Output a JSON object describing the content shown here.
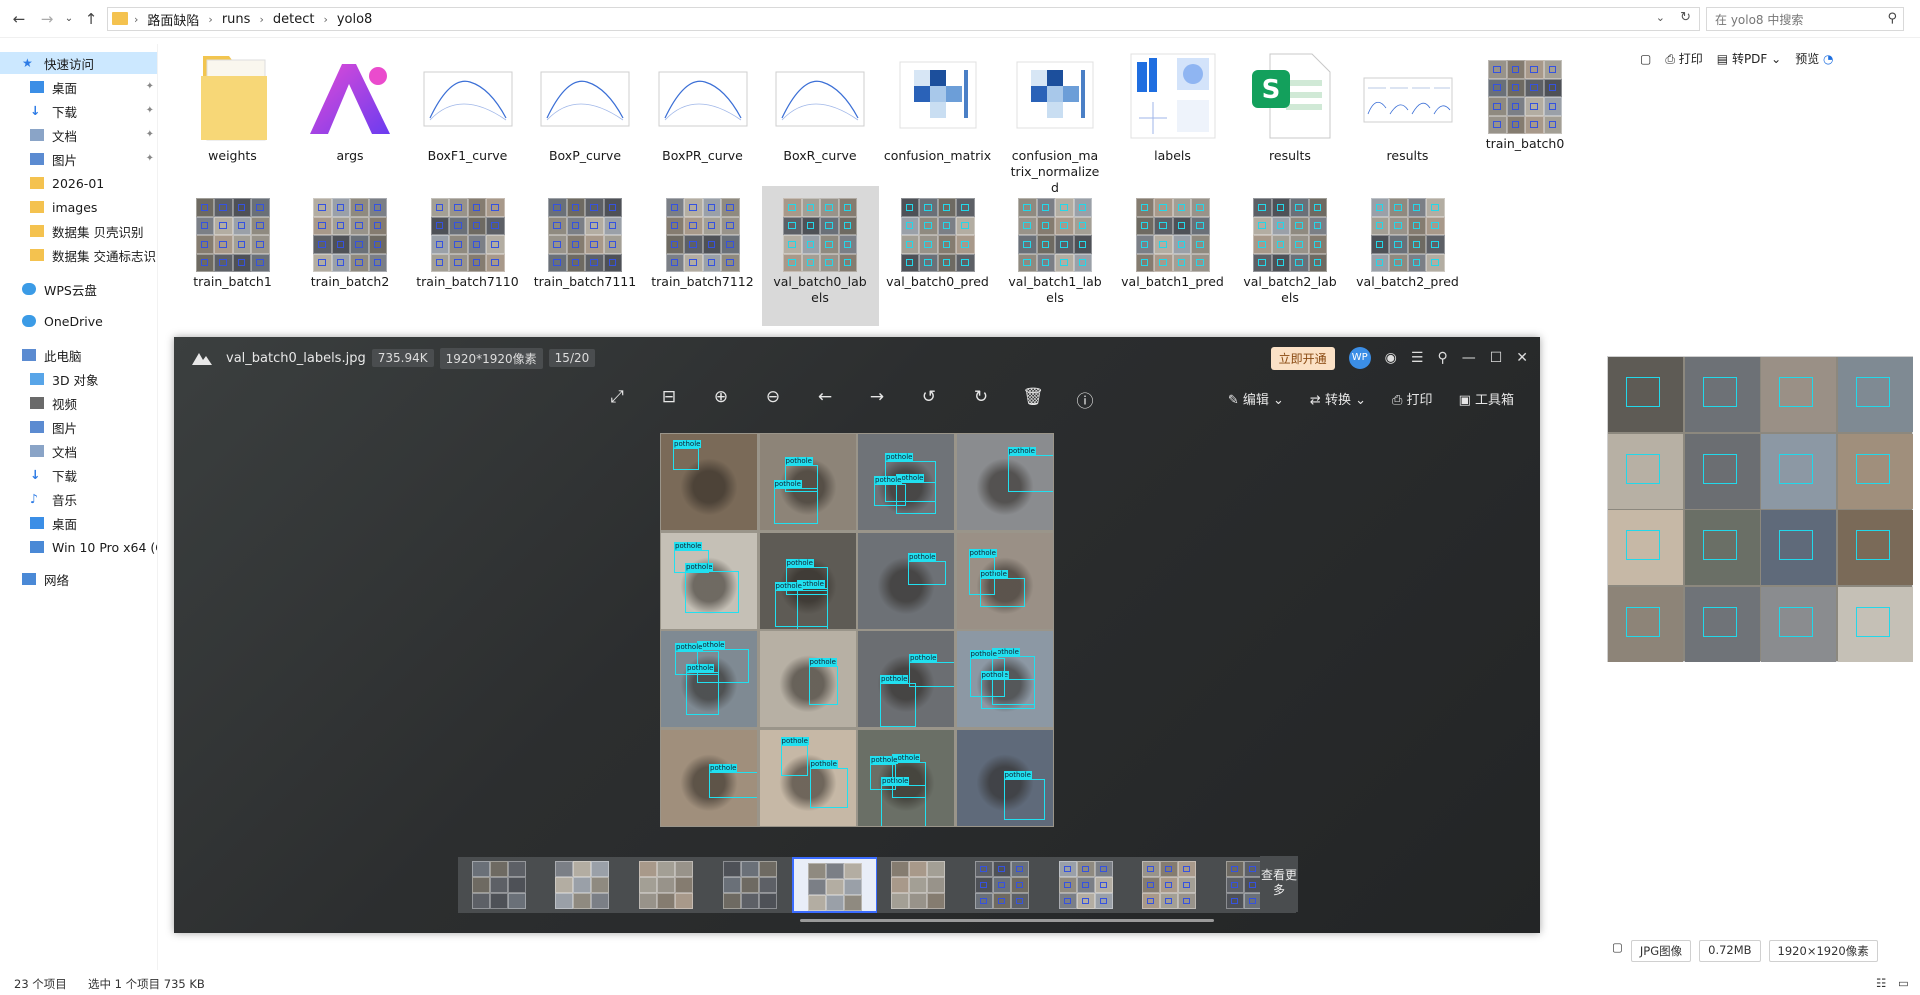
{
  "address": {
    "crumbs": [
      "路面缺陷",
      "runs",
      "detect",
      "yolo8"
    ],
    "search_placeholder": "在 yolo8 中搜索"
  },
  "sidebar": {
    "items": [
      {
        "label": "快速访问",
        "icon": "star-icon"
      },
      {
        "label": "桌面",
        "icon": "desktop-icon"
      },
      {
        "label": "下载",
        "icon": "download-icon"
      },
      {
        "label": "文档",
        "icon": "document-icon"
      },
      {
        "label": "图片",
        "icon": "picture-icon"
      },
      {
        "label": "2026-01",
        "icon": "folder-icon"
      },
      {
        "label": "images",
        "icon": "folder-icon"
      },
      {
        "label": "数据集 贝壳识别",
        "icon": "folder-icon"
      },
      {
        "label": "数据集 交通标志识",
        "icon": "folder-icon"
      },
      {
        "label": "WPS云盘",
        "icon": "cloud-icon"
      },
      {
        "label": "OneDrive",
        "icon": "cloud-icon"
      },
      {
        "label": "此电脑",
        "icon": "computer-icon"
      },
      {
        "label": "3D 对象",
        "icon": "cube-icon"
      },
      {
        "label": "视频",
        "icon": "video-icon"
      },
      {
        "label": "图片",
        "icon": "picture-icon"
      },
      {
        "label": "文档",
        "icon": "document-icon"
      },
      {
        "label": "下载",
        "icon": "download-icon"
      },
      {
        "label": "音乐",
        "icon": "music-icon"
      },
      {
        "label": "桌面",
        "icon": "desktop-icon"
      },
      {
        "label": "Win 10 Pro x64 (C",
        "icon": "drive-icon"
      },
      {
        "label": "网络",
        "icon": "network-icon"
      }
    ]
  },
  "files": [
    {
      "label": "weights",
      "kind": "folder"
    },
    {
      "label": "args",
      "kind": "app"
    },
    {
      "label": "BoxF1_curve",
      "kind": "curve"
    },
    {
      "label": "BoxP_curve",
      "kind": "curve"
    },
    {
      "label": "BoxPR_curve",
      "kind": "curve"
    },
    {
      "label": "BoxR_curve",
      "kind": "curve"
    },
    {
      "label": "confusion_matrix",
      "kind": "matrix"
    },
    {
      "label": "confusion_matrix_normalized",
      "kind": "matrix"
    },
    {
      "label": "labels",
      "kind": "labels"
    },
    {
      "label": "results",
      "kind": "sheet"
    },
    {
      "label": "results",
      "kind": "plots"
    },
    {
      "label": "train_batch0",
      "kind": "mosaic"
    },
    {
      "label": "train_batch1",
      "kind": "mosaic"
    },
    {
      "label": "train_batch2",
      "kind": "mosaic"
    },
    {
      "label": "train_batch7110",
      "kind": "mosaic"
    },
    {
      "label": "train_batch7111",
      "kind": "mosaic"
    },
    {
      "label": "train_batch7112",
      "kind": "mosaic"
    },
    {
      "label": "val_batch0_labels",
      "kind": "mosaic"
    },
    {
      "label": "val_batch0_pred",
      "kind": "mosaic"
    },
    {
      "label": "val_batch1_labels",
      "kind": "mosaic"
    },
    {
      "label": "val_batch1_pred",
      "kind": "mosaic"
    },
    {
      "label": "val_batch2_labels",
      "kind": "mosaic"
    },
    {
      "label": "val_batch2_pred",
      "kind": "mosaic"
    }
  ],
  "viewer": {
    "filename": "val_batch0_labels.jpg",
    "size": "735.94K",
    "dimensions": "1920*1920像素",
    "index": "15/20",
    "open_vip": "立即开通",
    "avatar_text": "WP",
    "tools_right": [
      "编辑",
      "转换",
      "打印",
      "工具箱"
    ],
    "more_label": "查看更多",
    "box_label": "pothole"
  },
  "preview": {
    "toolbar": [
      "打印",
      "转PDF",
      "预览"
    ],
    "type": "JPG图像",
    "size": "0.72MB",
    "dimensions": "1920×1920像素"
  },
  "status": {
    "count": "23 个项目",
    "selected": "选中 1 个项目  735 KB"
  }
}
